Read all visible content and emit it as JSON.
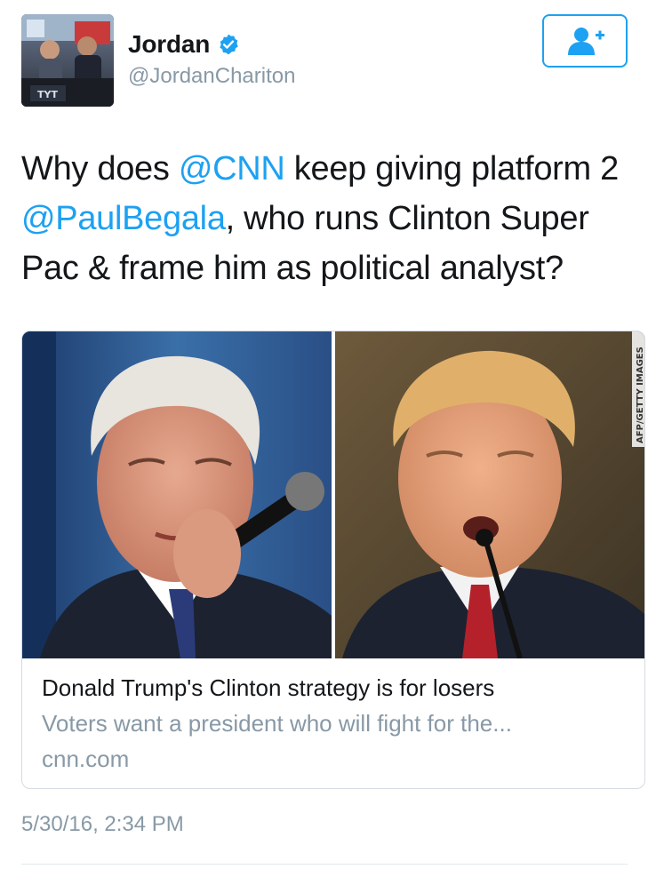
{
  "author": {
    "name": "Jordan",
    "handle": "@JordanChariton",
    "verified": true,
    "avatar_icon": "avatar-photo-news-studio"
  },
  "follow_button": {
    "icon": "add-user-icon"
  },
  "tweet": {
    "parts": [
      {
        "text": "Why does ",
        "mention": false
      },
      {
        "text": "@CNN",
        "mention": true
      },
      {
        "text": " keep giving platform 2 ",
        "mention": false
      },
      {
        "text": "@PaulBegala",
        "mention": true
      },
      {
        "text": ", who runs Clinton Super Pac & frame him as political analyst?",
        "mention": false
      }
    ]
  },
  "card": {
    "image_credit": "AFP/GETTY IMAGES",
    "title": "Donald Trump's Clinton strategy is for losers",
    "description": "Voters want a president who will fight for the...",
    "domain": "cnn.com"
  },
  "timestamp": "5/30/16, 2:34 PM",
  "colors": {
    "accent": "#1da1f2",
    "text": "#14171a",
    "muted": "#8899a6",
    "border": "#d5dbe0"
  }
}
